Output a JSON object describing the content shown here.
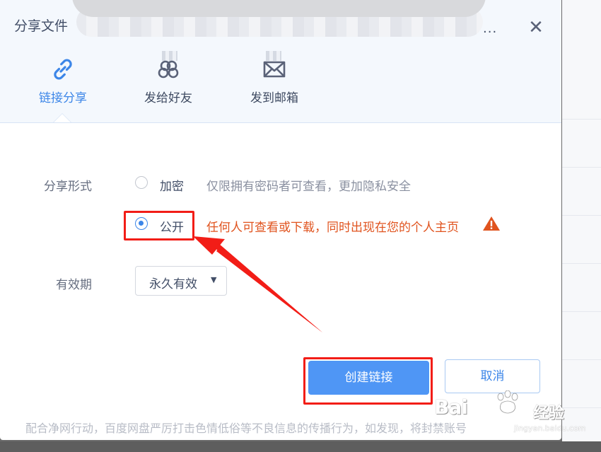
{
  "dialog": {
    "title": "分享文件",
    "more": "...",
    "close_symbol": "✕"
  },
  "tabs": [
    {
      "label": "链接分享",
      "icon": "link-icon",
      "active": true
    },
    {
      "label": "发给好友",
      "icon": "friends-icon",
      "active": false
    },
    {
      "label": "发到邮箱",
      "icon": "mail-icon",
      "active": false
    }
  ],
  "form": {
    "share_mode_label": "分享形式",
    "options": [
      {
        "label": "加密",
        "description": "仅限拥有密码者可查看，更加隐私安全",
        "checked": false
      },
      {
        "label": "公开",
        "description": "任何人可查看或下载，同时出现在您的个人主页",
        "checked": true
      }
    ],
    "validity_label": "有效期",
    "validity_value": "永久有效"
  },
  "buttons": {
    "create_link": "创建链接",
    "cancel": "取消"
  },
  "notice": "配合净网行动，百度网盘严厉打击色情低俗等不良信息的传播行为，如发现，将封禁账号",
  "watermark": {
    "brand": "Bai",
    "brand_suffix": "经验",
    "sub": "jingyan.baidu.com"
  },
  "colors": {
    "accent": "#3c86e8",
    "primary_button": "#4f96f5",
    "warning": "#e0531e",
    "annotation": "#f21d17"
  }
}
